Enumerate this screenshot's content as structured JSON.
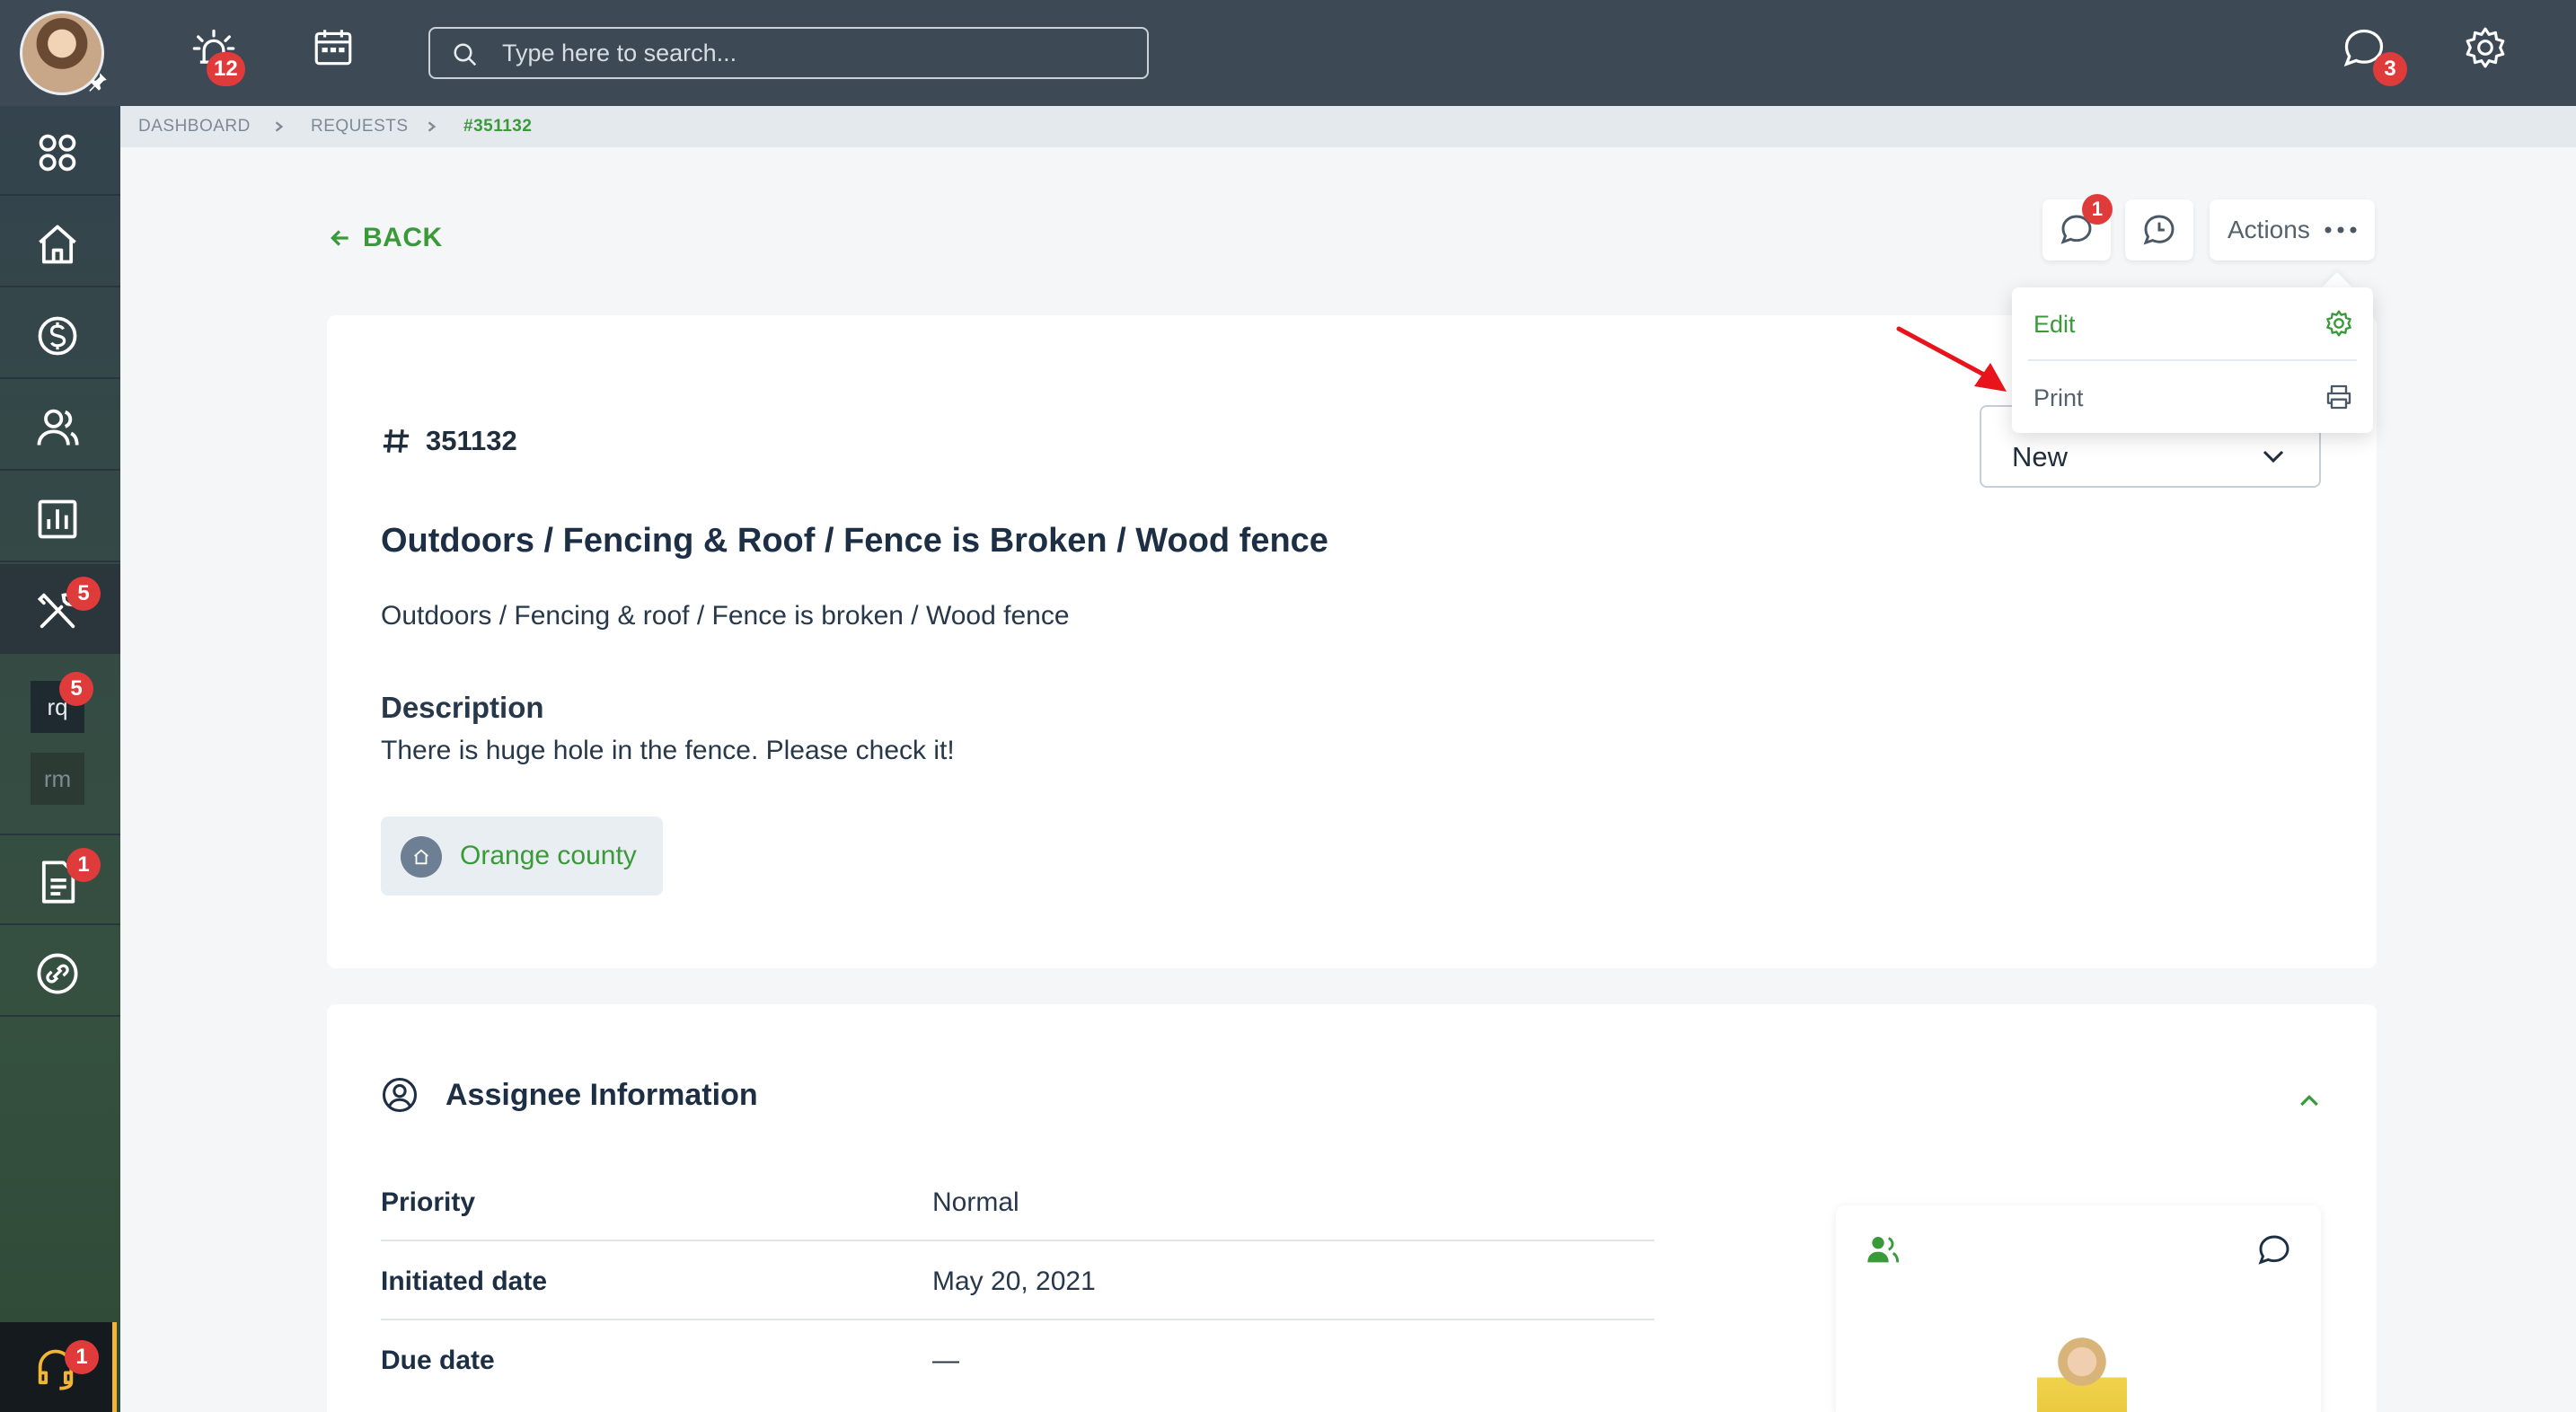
{
  "topbar": {
    "alerts_badge": "12",
    "search_placeholder": "Type here to search...",
    "messages_badge": "3"
  },
  "sidebar": {
    "maintenance_badge": "5",
    "sub_items": [
      {
        "label": "rq",
        "badge": "5"
      },
      {
        "label": "rm"
      }
    ],
    "documents_badge": "1",
    "support_badge": "1"
  },
  "breadcrumb": [
    "DASHBOARD",
    "REQUESTS",
    "#351132"
  ],
  "back_label": "BACK",
  "header_actions": {
    "comments_badge": "1",
    "actions_label": "Actions"
  },
  "menu": {
    "items": [
      {
        "label": "Edit",
        "icon": "gear-icon",
        "color": "#3a9a3a"
      },
      {
        "label": "Print",
        "icon": "printer-icon",
        "color": "#55626e"
      }
    ]
  },
  "request": {
    "id": "351132",
    "title": "Outdoors / Fencing & Roof / Fence is Broken / Wood fence",
    "subtitle": "Outdoors / Fencing & roof / Fence is broken / Wood fence",
    "description_label": "Description",
    "description": "There is huge hole in the fence. Please check it!",
    "location": "Orange county",
    "status": "New"
  },
  "assignee": {
    "heading": "Assignee Information",
    "rows": [
      {
        "label": "Priority",
        "value": "Normal"
      },
      {
        "label": "Initiated date",
        "value": "May 20, 2021"
      },
      {
        "label": "Due date",
        "value": "—"
      }
    ]
  },
  "colors": {
    "accent_green": "#3a9a3a",
    "badge_red": "#e03b3b",
    "topbar": "#3d4a55",
    "annotation_arrow": "#e8141c"
  }
}
